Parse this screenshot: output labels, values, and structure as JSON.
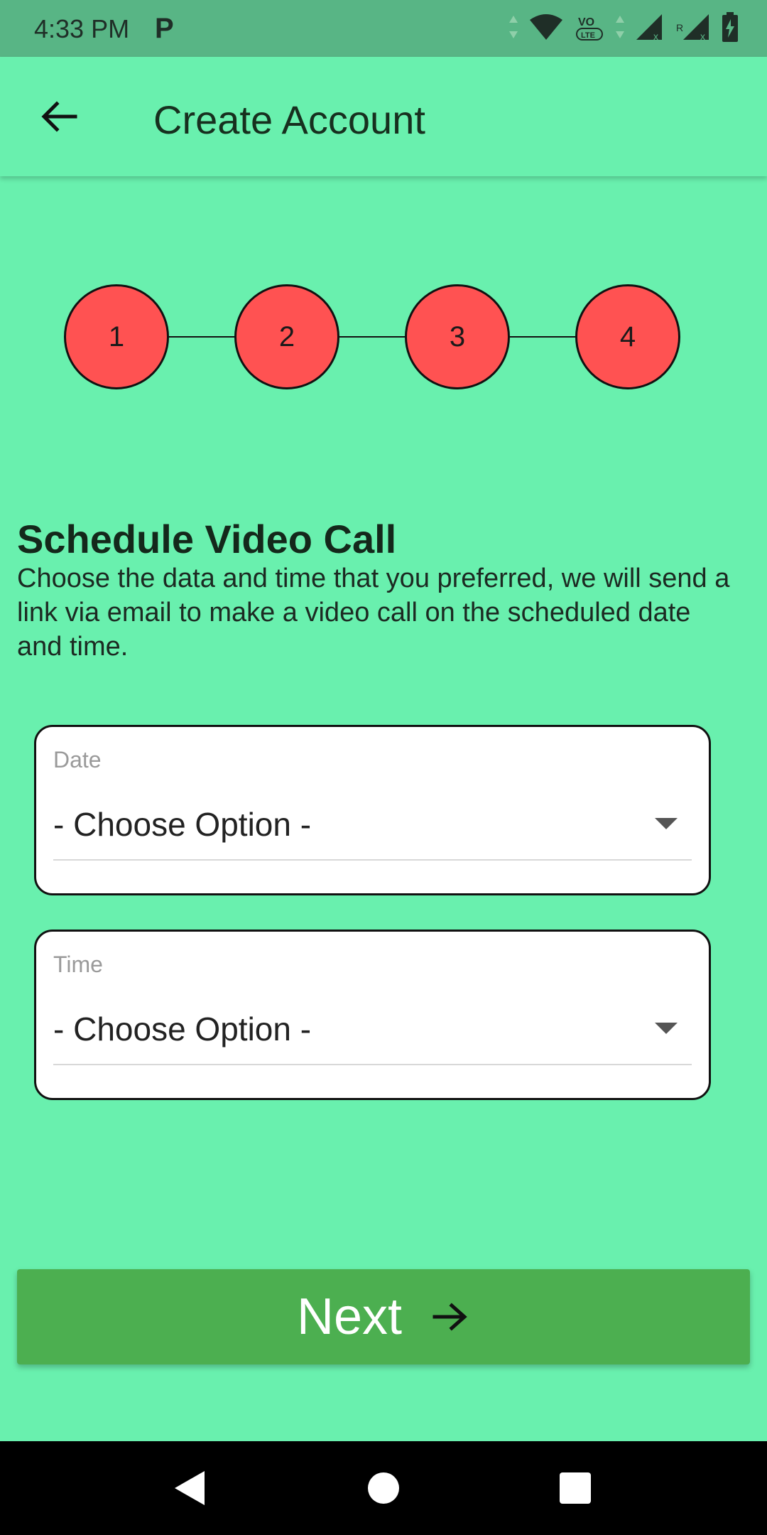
{
  "status_bar": {
    "time": "4:33 PM",
    "app_icon": "P",
    "icons": [
      "data-arrows-icon",
      "wifi-icon",
      "volte-icon",
      "signal-x-icon",
      "signal-roaming-icon",
      "battery-charging-icon"
    ],
    "volte_text": "VO",
    "lte_text": "LTE",
    "roaming_text": "R"
  },
  "appbar": {
    "title": "Create Account",
    "back_icon": "arrow-left-icon"
  },
  "stepper": {
    "steps": [
      "1",
      "2",
      "3",
      "4"
    ],
    "step_color": "#FF5252"
  },
  "section": {
    "title": "Schedule Video Call",
    "description": "Choose the data and time  that you preferred, we will send a link via email to make a video call on the scheduled date and time."
  },
  "form": {
    "date": {
      "label": "Date",
      "value": "- Choose Option -"
    },
    "time": {
      "label": "Time",
      "value": "- Choose Option -"
    }
  },
  "next_button": {
    "label": "Next",
    "icon": "arrow-right-icon",
    "color": "#4CAF50"
  },
  "nav_bar": {
    "buttons": [
      "back-triangle-icon",
      "home-circle-icon",
      "recents-square-icon"
    ]
  },
  "colors": {
    "background": "#69F0AE",
    "status_bar": "#58B585"
  }
}
